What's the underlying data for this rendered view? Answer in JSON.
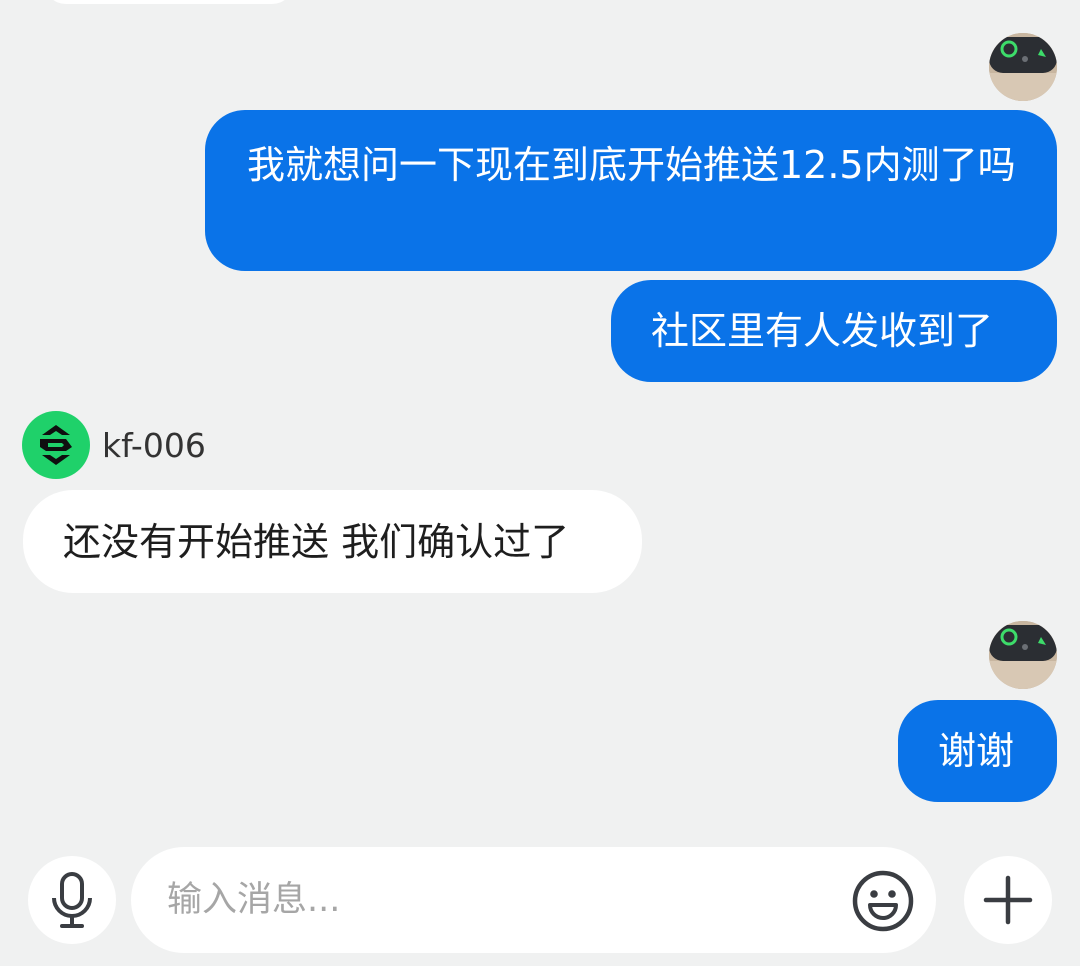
{
  "messages": [
    {
      "from": "user",
      "text": "我就想问一下现在到底开始推送12.5内测了吗"
    },
    {
      "from": "user",
      "text": "社区里有人发收到了"
    },
    {
      "from": "agent",
      "text": "还没有开始推送 我们确认过了"
    },
    {
      "from": "user",
      "text": "谢谢"
    }
  ],
  "agent": {
    "name": "kf-006",
    "avatar_color": "#1fd16a"
  },
  "composer": {
    "placeholder": "输入消息..."
  },
  "icons": [
    "microphone-icon",
    "emoji-icon",
    "plus-icon"
  ],
  "colors": {
    "outgoing_bubble": "#0a73e8",
    "incoming_bubble": "#ffffff",
    "background": "#f0f1f1"
  }
}
